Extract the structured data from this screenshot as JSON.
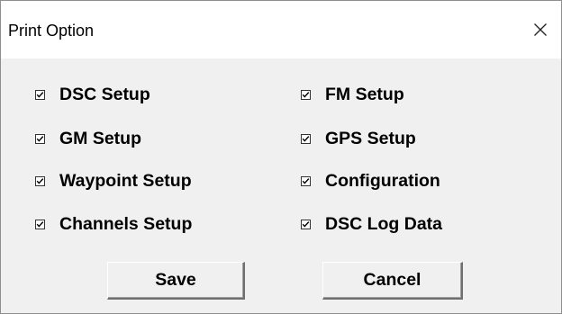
{
  "window": {
    "title": "Print Option",
    "close_icon": "close-icon"
  },
  "options": {
    "dsc_setup": {
      "label": "DSC Setup",
      "checked": true
    },
    "fm_setup": {
      "label": "FM Setup",
      "checked": true
    },
    "gm_setup": {
      "label": "GM Setup",
      "checked": true
    },
    "gps_setup": {
      "label": "GPS Setup",
      "checked": true
    },
    "waypoint_setup": {
      "label": "Waypoint Setup",
      "checked": true
    },
    "configuration": {
      "label": "Configuration",
      "checked": true
    },
    "channels_setup": {
      "label": "Channels Setup",
      "checked": true
    },
    "dsc_log_data": {
      "label": "DSC Log Data",
      "checked": true
    }
  },
  "buttons": {
    "save_label": "Save",
    "cancel_label": "Cancel"
  },
  "colors": {
    "dialog_background": "#f0f0f0",
    "titlebar_background": "#ffffff",
    "text": "#000000"
  }
}
